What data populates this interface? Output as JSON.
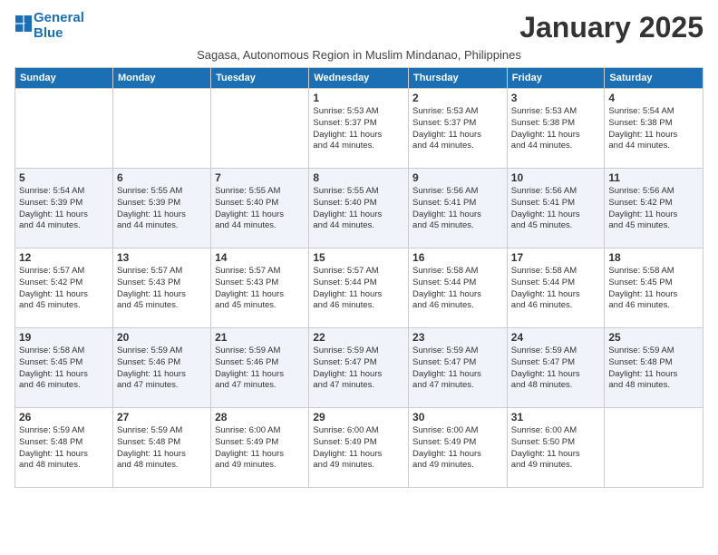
{
  "logo": {
    "line1": "General",
    "line2": "Blue"
  },
  "title": "January 2025",
  "subtitle": "Sagasa, Autonomous Region in Muslim Mindanao, Philippines",
  "weekdays": [
    "Sunday",
    "Monday",
    "Tuesday",
    "Wednesday",
    "Thursday",
    "Friday",
    "Saturday"
  ],
  "weeks": [
    [
      {
        "day": "",
        "info": ""
      },
      {
        "day": "",
        "info": ""
      },
      {
        "day": "",
        "info": ""
      },
      {
        "day": "1",
        "info": "Sunrise: 5:53 AM\nSunset: 5:37 PM\nDaylight: 11 hours\nand 44 minutes."
      },
      {
        "day": "2",
        "info": "Sunrise: 5:53 AM\nSunset: 5:37 PM\nDaylight: 11 hours\nand 44 minutes."
      },
      {
        "day": "3",
        "info": "Sunrise: 5:53 AM\nSunset: 5:38 PM\nDaylight: 11 hours\nand 44 minutes."
      },
      {
        "day": "4",
        "info": "Sunrise: 5:54 AM\nSunset: 5:38 PM\nDaylight: 11 hours\nand 44 minutes."
      }
    ],
    [
      {
        "day": "5",
        "info": "Sunrise: 5:54 AM\nSunset: 5:39 PM\nDaylight: 11 hours\nand 44 minutes."
      },
      {
        "day": "6",
        "info": "Sunrise: 5:55 AM\nSunset: 5:39 PM\nDaylight: 11 hours\nand 44 minutes."
      },
      {
        "day": "7",
        "info": "Sunrise: 5:55 AM\nSunset: 5:40 PM\nDaylight: 11 hours\nand 44 minutes."
      },
      {
        "day": "8",
        "info": "Sunrise: 5:55 AM\nSunset: 5:40 PM\nDaylight: 11 hours\nand 44 minutes."
      },
      {
        "day": "9",
        "info": "Sunrise: 5:56 AM\nSunset: 5:41 PM\nDaylight: 11 hours\nand 45 minutes."
      },
      {
        "day": "10",
        "info": "Sunrise: 5:56 AM\nSunset: 5:41 PM\nDaylight: 11 hours\nand 45 minutes."
      },
      {
        "day": "11",
        "info": "Sunrise: 5:56 AM\nSunset: 5:42 PM\nDaylight: 11 hours\nand 45 minutes."
      }
    ],
    [
      {
        "day": "12",
        "info": "Sunrise: 5:57 AM\nSunset: 5:42 PM\nDaylight: 11 hours\nand 45 minutes."
      },
      {
        "day": "13",
        "info": "Sunrise: 5:57 AM\nSunset: 5:43 PM\nDaylight: 11 hours\nand 45 minutes."
      },
      {
        "day": "14",
        "info": "Sunrise: 5:57 AM\nSunset: 5:43 PM\nDaylight: 11 hours\nand 45 minutes."
      },
      {
        "day": "15",
        "info": "Sunrise: 5:57 AM\nSunset: 5:44 PM\nDaylight: 11 hours\nand 46 minutes."
      },
      {
        "day": "16",
        "info": "Sunrise: 5:58 AM\nSunset: 5:44 PM\nDaylight: 11 hours\nand 46 minutes."
      },
      {
        "day": "17",
        "info": "Sunrise: 5:58 AM\nSunset: 5:44 PM\nDaylight: 11 hours\nand 46 minutes."
      },
      {
        "day": "18",
        "info": "Sunrise: 5:58 AM\nSunset: 5:45 PM\nDaylight: 11 hours\nand 46 minutes."
      }
    ],
    [
      {
        "day": "19",
        "info": "Sunrise: 5:58 AM\nSunset: 5:45 PM\nDaylight: 11 hours\nand 46 minutes."
      },
      {
        "day": "20",
        "info": "Sunrise: 5:59 AM\nSunset: 5:46 PM\nDaylight: 11 hours\nand 47 minutes."
      },
      {
        "day": "21",
        "info": "Sunrise: 5:59 AM\nSunset: 5:46 PM\nDaylight: 11 hours\nand 47 minutes."
      },
      {
        "day": "22",
        "info": "Sunrise: 5:59 AM\nSunset: 5:47 PM\nDaylight: 11 hours\nand 47 minutes."
      },
      {
        "day": "23",
        "info": "Sunrise: 5:59 AM\nSunset: 5:47 PM\nDaylight: 11 hours\nand 47 minutes."
      },
      {
        "day": "24",
        "info": "Sunrise: 5:59 AM\nSunset: 5:47 PM\nDaylight: 11 hours\nand 48 minutes."
      },
      {
        "day": "25",
        "info": "Sunrise: 5:59 AM\nSunset: 5:48 PM\nDaylight: 11 hours\nand 48 minutes."
      }
    ],
    [
      {
        "day": "26",
        "info": "Sunrise: 5:59 AM\nSunset: 5:48 PM\nDaylight: 11 hours\nand 48 minutes."
      },
      {
        "day": "27",
        "info": "Sunrise: 5:59 AM\nSunset: 5:48 PM\nDaylight: 11 hours\nand 48 minutes."
      },
      {
        "day": "28",
        "info": "Sunrise: 6:00 AM\nSunset: 5:49 PM\nDaylight: 11 hours\nand 49 minutes."
      },
      {
        "day": "29",
        "info": "Sunrise: 6:00 AM\nSunset: 5:49 PM\nDaylight: 11 hours\nand 49 minutes."
      },
      {
        "day": "30",
        "info": "Sunrise: 6:00 AM\nSunset: 5:49 PM\nDaylight: 11 hours\nand 49 minutes."
      },
      {
        "day": "31",
        "info": "Sunrise: 6:00 AM\nSunset: 5:50 PM\nDaylight: 11 hours\nand 49 minutes."
      },
      {
        "day": "",
        "info": ""
      }
    ]
  ]
}
